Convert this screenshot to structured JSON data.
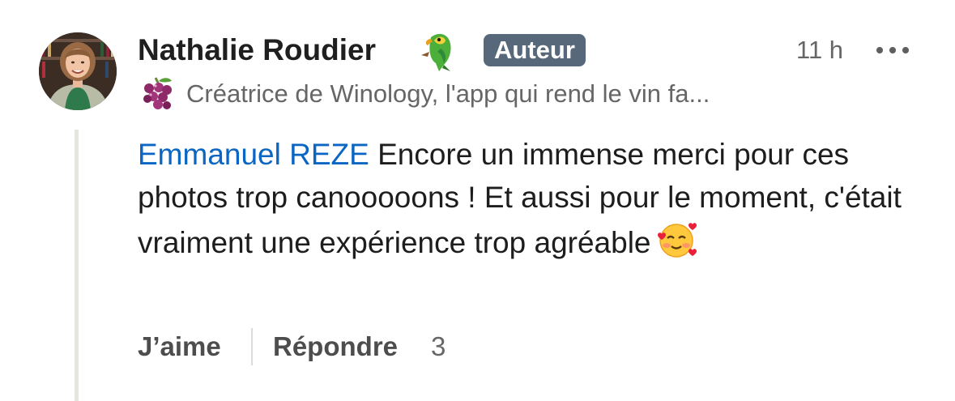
{
  "comment": {
    "author": {
      "name": "Nathalie Roudier",
      "name_icon": "parrot-icon",
      "badge": "Auteur",
      "headline_icon": "grapes-icon",
      "headline": "Créatrice de Winology, l'app qui rend le vin fa..."
    },
    "timestamp": "11 h",
    "more_icon": "more-options-icon",
    "mention": "Emmanuel REZE",
    "text": " Encore un immense merci pour ces photos trop canooooons ! Et aussi pour le moment, c'était vraiment une expérience trop agréable",
    "text_emoji": "smiling-face-with-hearts-icon",
    "actions": {
      "like_label": "J’aime",
      "reply_label": "Répondre",
      "reply_count": "3"
    }
  },
  "colors": {
    "mention": "#0a66c2",
    "badge_bg": "#56687a",
    "secondary_text": "#666666",
    "thread_line": "#e6e6e1"
  }
}
